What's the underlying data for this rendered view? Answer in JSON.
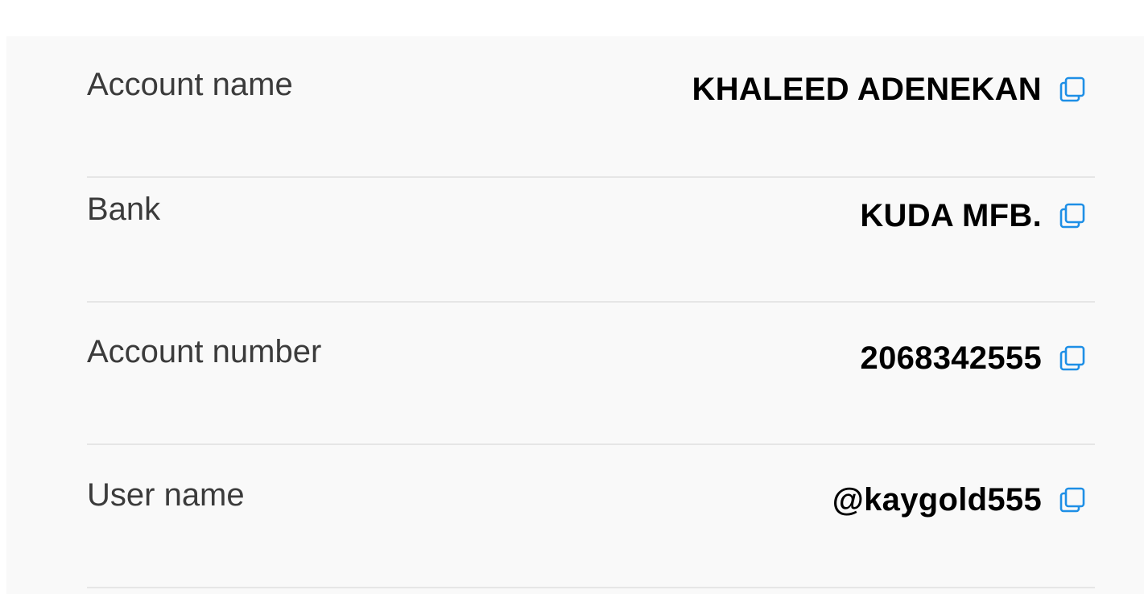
{
  "details": {
    "rows": [
      {
        "label": "Account name",
        "value": "KHALEED ADENEKAN",
        "copy_icon": "copy-icon"
      },
      {
        "label": "Bank",
        "value": "KUDA MFB.",
        "copy_icon": "copy-icon"
      },
      {
        "label": "Account number",
        "value": "2068342555",
        "copy_icon": "copy-icon"
      },
      {
        "label": "User name",
        "value": "@kaygold555",
        "copy_icon": "copy-icon"
      }
    ]
  },
  "colors": {
    "card_background": "#f9f9f9",
    "label_text": "#3b3b3b",
    "value_text": "#000000",
    "copy_icon": "#1e8fe6",
    "divider": "#e6e6e6"
  }
}
